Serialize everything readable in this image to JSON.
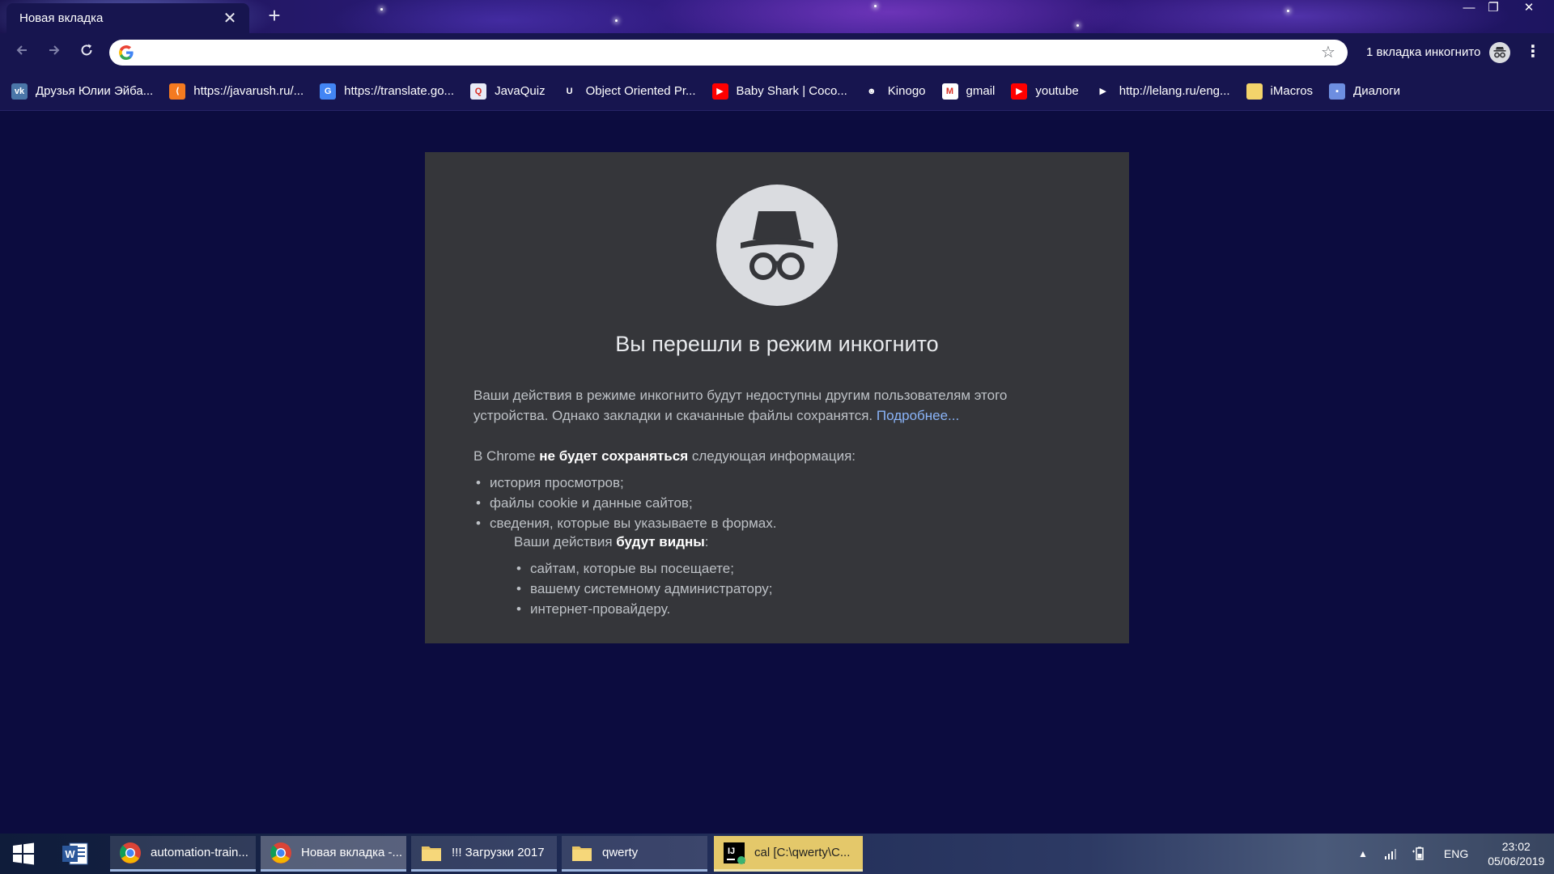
{
  "window": {
    "tab_title": "Новая вкладка",
    "tab_close": "✕",
    "new_tab": "+",
    "minimize": "—",
    "restore": "❐",
    "close": "✕"
  },
  "toolbar": {
    "back_icon": "arrow-left-icon",
    "forward_icon": "arrow-right-icon",
    "reload_icon": "reload-icon",
    "omnibox_value": "",
    "omnibox_placeholder": "",
    "bookmark_star": "☆",
    "incognito_label": "1 вкладка инкогнито",
    "menu": "⋮"
  },
  "bookmarks": [
    {
      "label": "Друзья Юлии Эйба...",
      "icon": "vk-icon",
      "color": "#4a76a8",
      "glyph": "vk"
    },
    {
      "label": "https://javarush.ru/...",
      "icon": "javarush-icon",
      "color": "#f47a20",
      "glyph": "⟨"
    },
    {
      "label": "https://translate.go...",
      "icon": "google-translate-icon",
      "color": "#4285f4",
      "glyph": "G"
    },
    {
      "label": "JavaQuiz",
      "icon": "javaquiz-icon",
      "color": "#e8eaf6",
      "glyph": "Q"
    },
    {
      "label": "Object Oriented Pr...",
      "icon": "udemy-icon",
      "color": "#17154f",
      "glyph": "U"
    },
    {
      "label": "Baby Shark | Coco...",
      "icon": "youtube-icon",
      "color": "#ff0000",
      "glyph": "▶"
    },
    {
      "label": "Kinogo",
      "icon": "kinogo-icon",
      "color": "#17154f",
      "glyph": "☻"
    },
    {
      "label": "gmail",
      "icon": "gmail-icon",
      "color": "#ffffff",
      "glyph": "M"
    },
    {
      "label": "youtube",
      "icon": "youtube-icon",
      "color": "#ff0000",
      "glyph": "▶"
    },
    {
      "label": "http://lelang.ru/eng...",
      "icon": "lelang-icon",
      "color": "#17154f",
      "glyph": "▶"
    },
    {
      "label": "iMacros",
      "icon": "folder-icon",
      "color": "#f3d36b",
      "glyph": ""
    },
    {
      "label": "Диалоги",
      "icon": "chat-icon",
      "color": "#6d8ee0",
      "glyph": "▪"
    }
  ],
  "incognito": {
    "title": "Вы перешли в режим инкогнито",
    "paragraph": "Ваши действия в режиме инкогнито будут недоступны другим пользователям этого устройства. Однако закладки и скачанные файлы сохранятся.",
    "learn_more": "Подробнее...",
    "not_saved_prefix": "В Chrome",
    "not_saved_bold": "не будет сохраняться",
    "not_saved_suffix": "следующая информация:",
    "not_saved_items": [
      "история просмотров;",
      "файлы cookie и данные сайтов;",
      "сведения, которые вы указываете в формах."
    ],
    "visible_prefix": "Ваши действия",
    "visible_bold": "будут видны",
    "visible_suffix": ":",
    "visible_items": [
      "сайтам, которые вы посещаете;",
      "вашему системному администратору;",
      "интернет-провайдеру."
    ]
  },
  "taskbar": {
    "buttons": [
      {
        "label": "automation-train...",
        "icon": "chrome-icon"
      },
      {
        "label": "Новая вкладка -...",
        "icon": "chrome-icon"
      },
      {
        "label": "!!! Загрузки 2017",
        "icon": "folder-icon"
      },
      {
        "label": "qwerty",
        "icon": "folder-icon"
      },
      {
        "label": "cal [C:\\qwerty\\C...",
        "icon": "intellij-icon"
      }
    ],
    "tray": {
      "language": "ENG",
      "time": "23:02",
      "date": "05/06/2019"
    }
  },
  "colors": {
    "page_bg": "#0c0c3f",
    "chrome_frame": "#17154f",
    "panel_bg": "#35363a",
    "link": "#8ab4f8"
  }
}
